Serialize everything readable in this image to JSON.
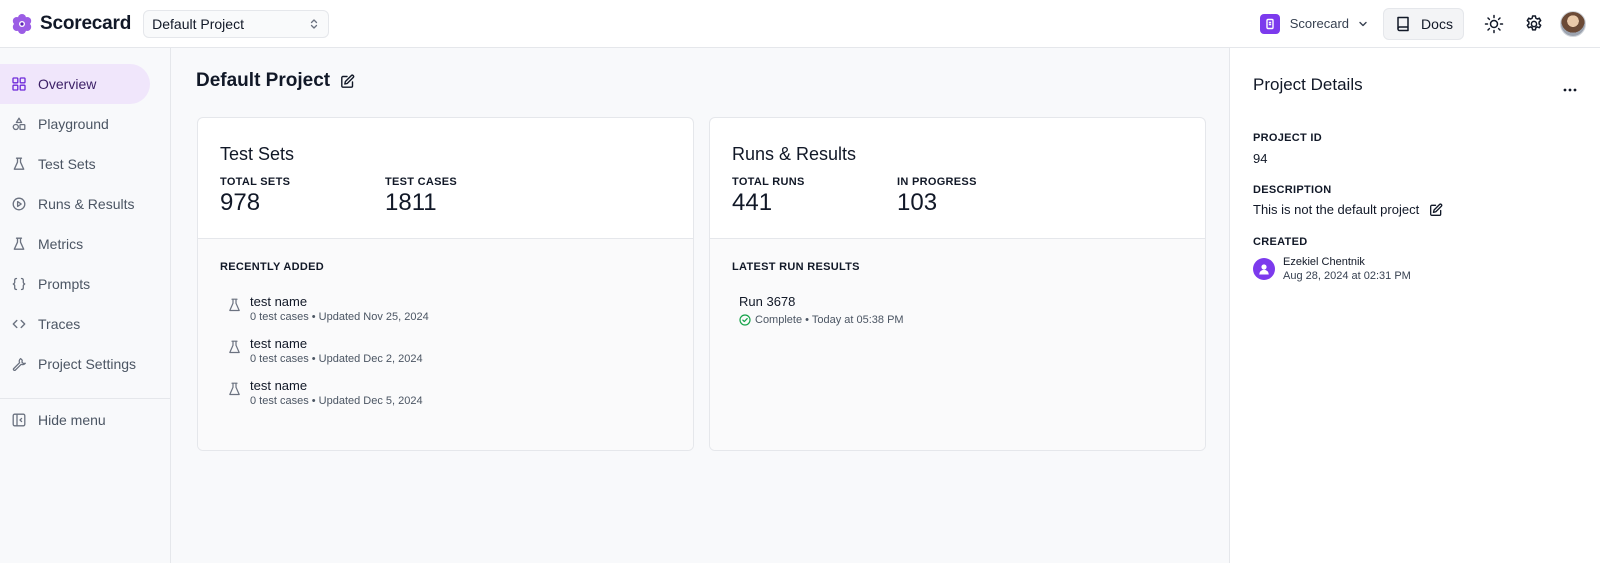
{
  "header": {
    "brand": "Scorecard",
    "brand_icon": "flower-logo-icon",
    "project_select": "Default Project",
    "org_name": "Scorecard",
    "docs_label": "Docs",
    "accent_color": "#7c3aed"
  },
  "sidebar": {
    "items": [
      {
        "label": "Overview",
        "icon": "grid-icon",
        "active": true
      },
      {
        "label": "Playground",
        "icon": "shapes-icon"
      },
      {
        "label": "Test Sets",
        "icon": "flask-icon"
      },
      {
        "label": "Runs & Results",
        "icon": "play-circle-icon"
      },
      {
        "label": "Metrics",
        "icon": "flask-icon"
      },
      {
        "label": "Prompts",
        "icon": "braces-icon"
      },
      {
        "label": "Traces",
        "icon": "code-icon"
      },
      {
        "label": "Project Settings",
        "icon": "wrench-icon"
      }
    ],
    "hide_menu": "Hide menu"
  },
  "main": {
    "title": "Default Project",
    "test_sets": {
      "title": "Test Sets",
      "stat1_label": "TOTAL SETS",
      "stat1_value": "978",
      "stat2_label": "TEST CASES",
      "stat2_value": "1811",
      "section_label": "RECENTLY ADDED",
      "items": [
        {
          "name": "test name",
          "meta": "0 test cases • Updated Nov 25, 2024"
        },
        {
          "name": "test name",
          "meta": "0 test cases • Updated Dec 2, 2024"
        },
        {
          "name": "test name",
          "meta": "0 test cases • Updated Dec 5, 2024"
        }
      ]
    },
    "runs": {
      "title": "Runs & Results",
      "stat1_label": "TOTAL RUNS",
      "stat1_value": "441",
      "stat2_label": "IN PROGRESS",
      "stat2_value": "103",
      "section_label": "LATEST RUN RESULTS",
      "run_name": "Run 3678",
      "run_status": "Complete",
      "run_time": "• Today at 05:38 PM"
    }
  },
  "details": {
    "title": "Project Details",
    "project_id_label": "PROJECT ID",
    "project_id": "94",
    "description_label": "DESCRIPTION",
    "description": "This is not the default project",
    "created_label": "CREATED",
    "creator_name": "Ezekiel Chentnik",
    "created_date": "Aug 28, 2024 at 02:31 PM"
  }
}
